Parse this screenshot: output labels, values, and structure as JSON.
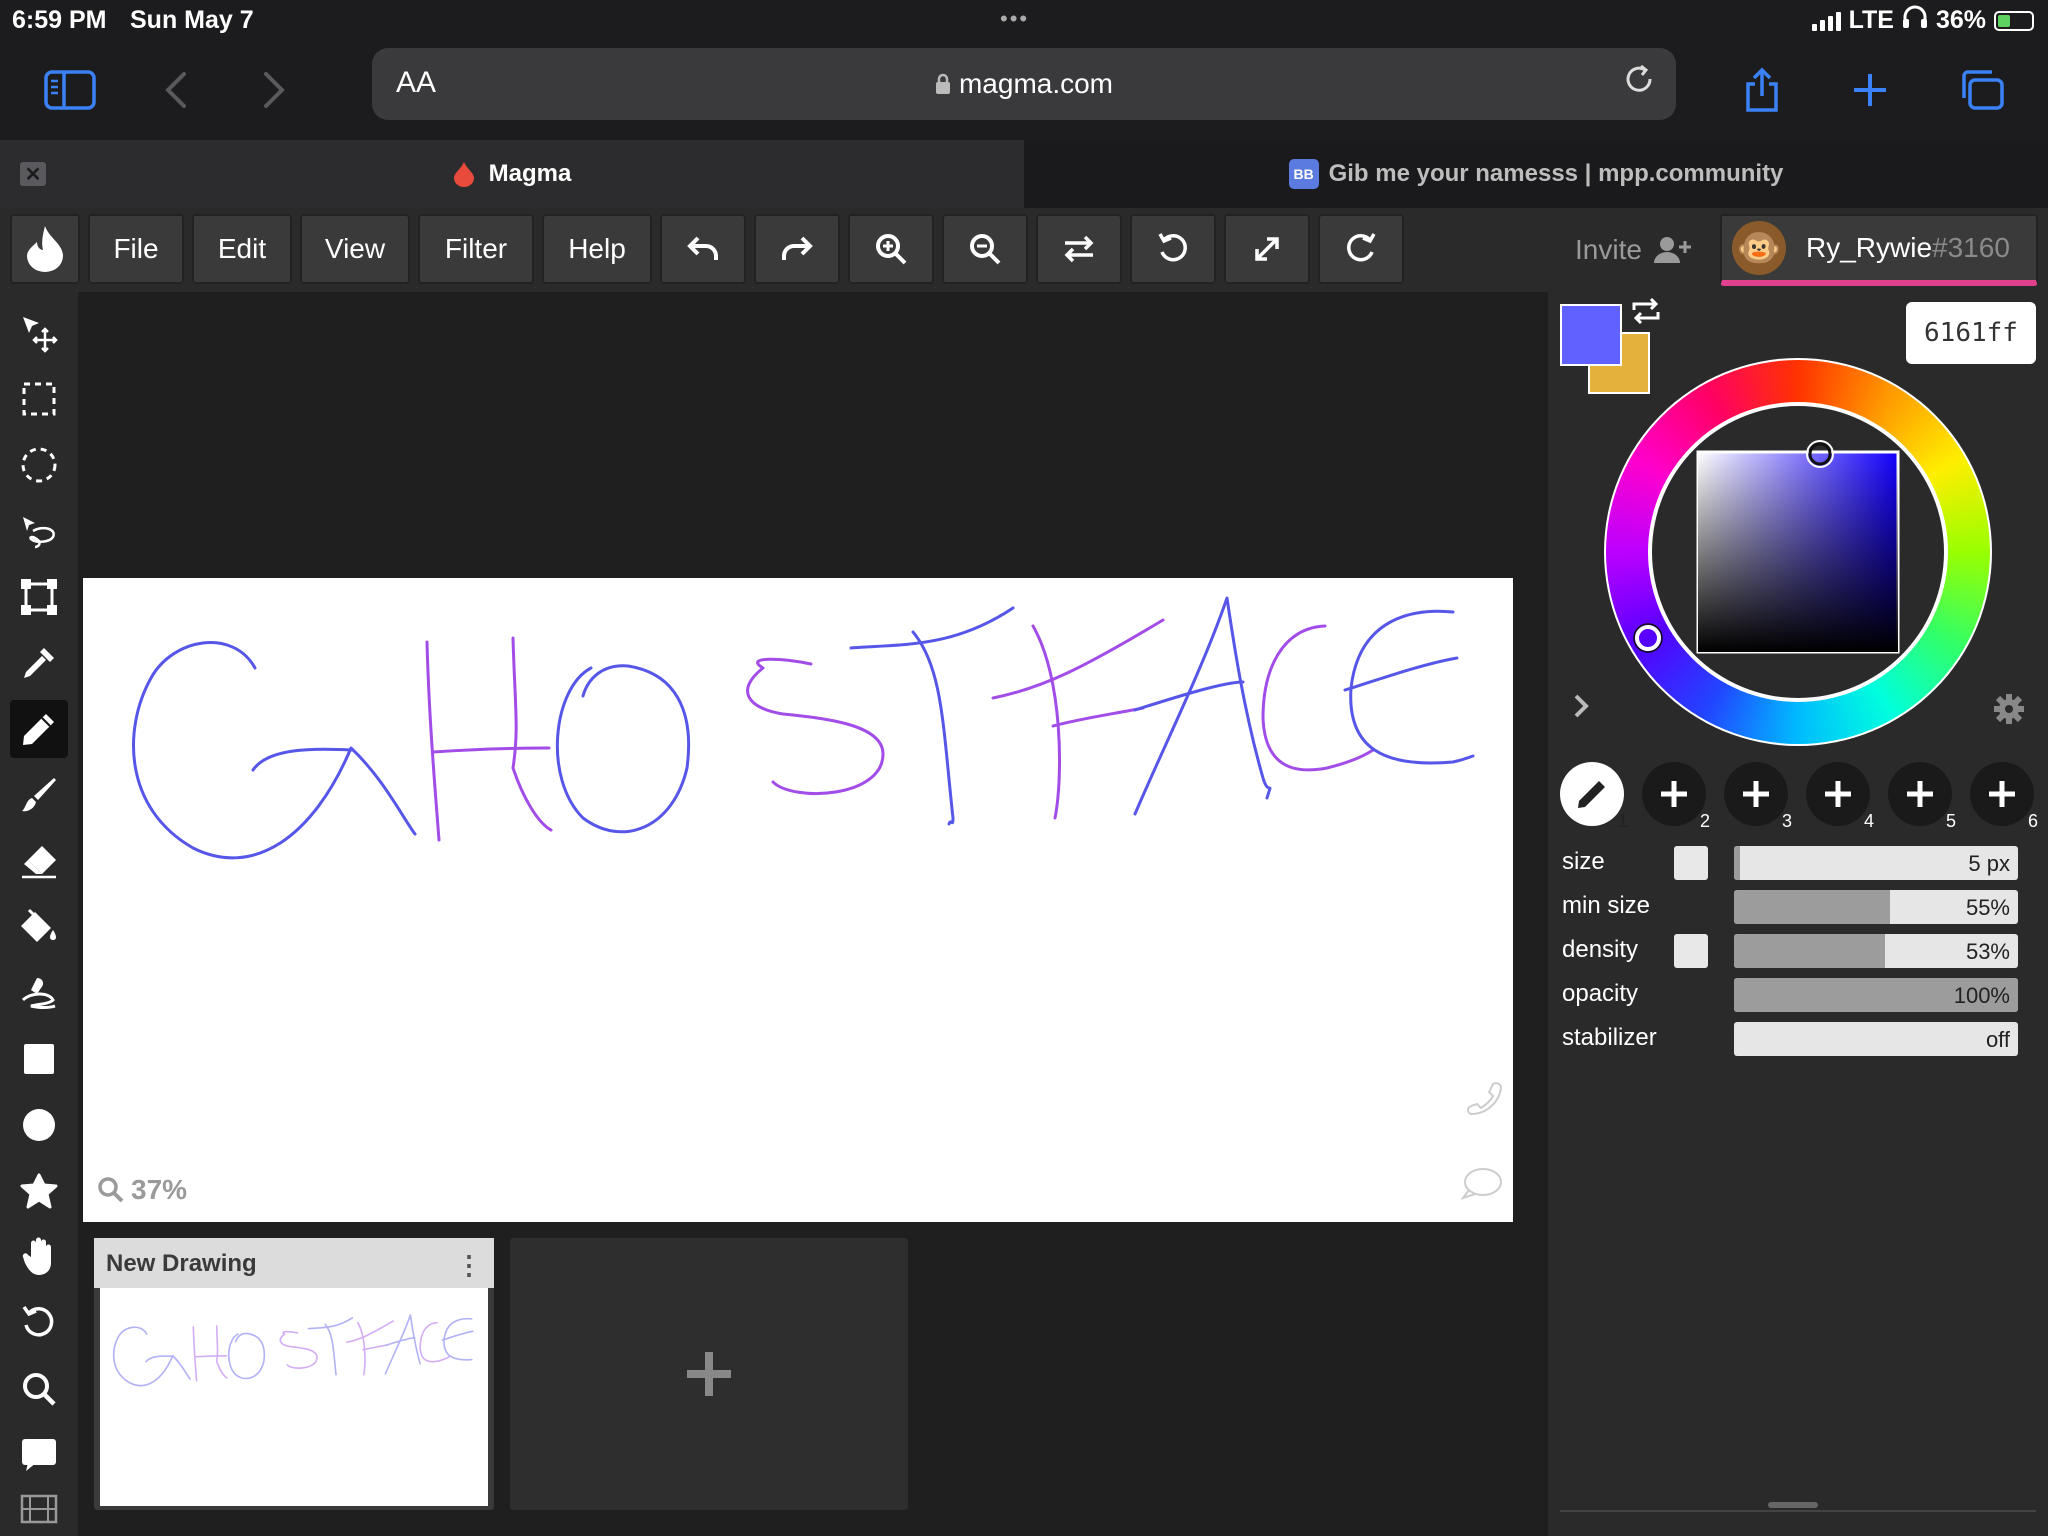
{
  "status_bar": {
    "time": "6:59 PM",
    "date": "Sun May 7",
    "network": "LTE",
    "battery": "36%"
  },
  "browser": {
    "url": "magma.com",
    "text_size_label": "AA",
    "tabs": [
      {
        "title": "Magma",
        "active": true
      },
      {
        "title": "Gib me your namesss | mpp.community",
        "active": false
      }
    ],
    "accent_color": "#3b82f6"
  },
  "menu": {
    "items": [
      "File",
      "Edit",
      "View",
      "Filter",
      "Help"
    ],
    "toolbar_icons": [
      "undo-icon",
      "redo-icon",
      "zoom-in-icon",
      "zoom-out-icon",
      "flip-icon",
      "rotate-left-icon",
      "fullscreen-icon",
      "rotate-right-icon"
    ],
    "invite_label": "Invite",
    "user": {
      "name": "Ry_Rywie",
      "tag": "#3160",
      "accent": "#e0418f"
    }
  },
  "tools": [
    "move-icon",
    "rect-select-icon",
    "ellipse-select-icon",
    "lasso-icon",
    "transform-icon",
    "eyedropper-icon",
    "pencil-icon",
    "brush-icon",
    "eraser-icon",
    "bucket-icon",
    "smudge-icon",
    "rectangle-icon",
    "ellipse-icon",
    "shape-icon",
    "hand-icon",
    "rotate-view-icon",
    "zoom-icon",
    "comment-icon",
    "film-icon"
  ],
  "canvas": {
    "zoom_label": "37%",
    "drawing_text": "GHOSTFACE"
  },
  "drawings": [
    {
      "title": "New Drawing"
    }
  ],
  "color": {
    "primary": "#6161ff",
    "secondary": "#e4b23a",
    "hex": "6161ff"
  },
  "brush_slots": [
    "1",
    "2",
    "3",
    "4",
    "5",
    "6"
  ],
  "brush_props": [
    {
      "label": "size",
      "value": "5 px",
      "fill": 0.02,
      "checkbox": true
    },
    {
      "label": "min size",
      "value": "55%",
      "fill": 0.55,
      "checkbox": false
    },
    {
      "label": "density",
      "value": "53%",
      "fill": 0.53,
      "checkbox": true
    },
    {
      "label": "opacity",
      "value": "100%",
      "fill": 1.0,
      "checkbox": false
    },
    {
      "label": "stabilizer",
      "value": "off",
      "fill": 0,
      "checkbox": false
    }
  ]
}
